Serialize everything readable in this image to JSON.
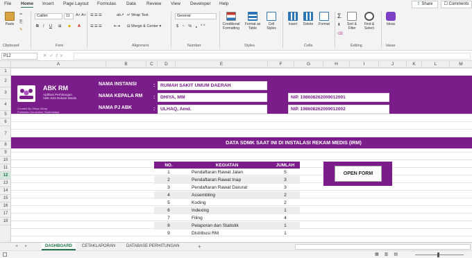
{
  "menu": {
    "items": [
      "File",
      "Home",
      "Insert",
      "Page Layout",
      "Formulas",
      "Data",
      "Review",
      "View",
      "Developer",
      "Help"
    ],
    "active": "Home",
    "share": "Share",
    "comments": "Comments"
  },
  "ribbon": {
    "paste": "Paste",
    "font_name": "Calibri",
    "font_size": "11",
    "wrap_text": "Wrap Text",
    "merge_center": "Merge & Center",
    "number_format": "General",
    "conditional_formatting": "Conditional Formatting",
    "format_as_table": "Format as Table",
    "cell_styles": "Cell Styles",
    "insert": "Insert",
    "delete": "Delete",
    "format": "Format",
    "sort_filter": "Sort & Filter",
    "find_select": "Find & Select",
    "ideas": "Ideas",
    "groups": [
      "Clipboard",
      "Font",
      "Alignment",
      "Number",
      "Styles",
      "Cells",
      "Editing",
      "Ideas"
    ]
  },
  "formula_bar": {
    "name_box": "P12",
    "fx": "fx",
    "formula": ""
  },
  "columns": [
    "A",
    "B",
    "C",
    "D",
    "E",
    "F",
    "G",
    "H",
    "I",
    "J",
    "K",
    "L",
    "M"
  ],
  "rows": [
    "1",
    "2",
    "3",
    "4",
    "5",
    "6",
    "7",
    "8",
    "9",
    "10",
    "11",
    "12",
    "13",
    "14",
    "15",
    "16",
    "17",
    "18"
  ],
  "selected_row": "12",
  "header": {
    "app_title": "ABK RM",
    "app_subtitle_1": "Aplikasi Perhitungan",
    "app_subtitle_2": "ABK-Kes Rekam Medis",
    "credit_1": "Created By Dhiya Ulhaq",
    "credit_2": "Poltekkes Kemenkes Tasikmalaya",
    "labels": {
      "instansi": "NAMA INSTANSI",
      "kepala": "NAMA KEPALA RM",
      "pj": "NAMA PJ ABK",
      "colon": ":"
    },
    "values": {
      "instansi": "RUMAH SAKIT UMUM DAERAH",
      "kepala": "DHIYA, MM",
      "pj": "ULHAQ, Amd."
    },
    "nip_kepala": "NIP. 198608262009012001",
    "nip_pj": "NIP. 198608262009012002"
  },
  "section_title": "DATA SDMK SAAT INI DI INSTALASI REKAM MEDIS (IRM)",
  "table": {
    "headers": {
      "no": "NO.",
      "kegiatan": "KEGIATAN",
      "jumlah": "JUMLAH"
    },
    "rows": [
      {
        "no": "1",
        "kegiatan": "Pendaftaran Rawat Jalan",
        "jumlah": "5"
      },
      {
        "no": "2",
        "kegiatan": "Pendaftaran Rawat Inap",
        "jumlah": "3"
      },
      {
        "no": "3",
        "kegiatan": "Pendaftaran Rawat Darurat",
        "jumlah": "3"
      },
      {
        "no": "4",
        "kegiatan": "Assembling",
        "jumlah": "2"
      },
      {
        "no": "5",
        "kegiatan": "Koding",
        "jumlah": "2"
      },
      {
        "no": "6",
        "kegiatan": "Indexing",
        "jumlah": "1"
      },
      {
        "no": "7",
        "kegiatan": "Filing",
        "jumlah": "4"
      },
      {
        "no": "8",
        "kegiatan": "Pelaporan dan Statistik",
        "jumlah": "1"
      },
      {
        "no": "9",
        "kegiatan": "Distribusi RM",
        "jumlah": "1"
      }
    ]
  },
  "open_form": "OPEN FORM",
  "tabs": [
    "DASHBOARD",
    "CETAKLAPORAN",
    "DATABASE PERHITUNGAN"
  ],
  "active_tab": "DASHBOARD",
  "add_sheet": "+",
  "colors": {
    "accent": "#7a1c8a",
    "excel_green": "#217346"
  }
}
